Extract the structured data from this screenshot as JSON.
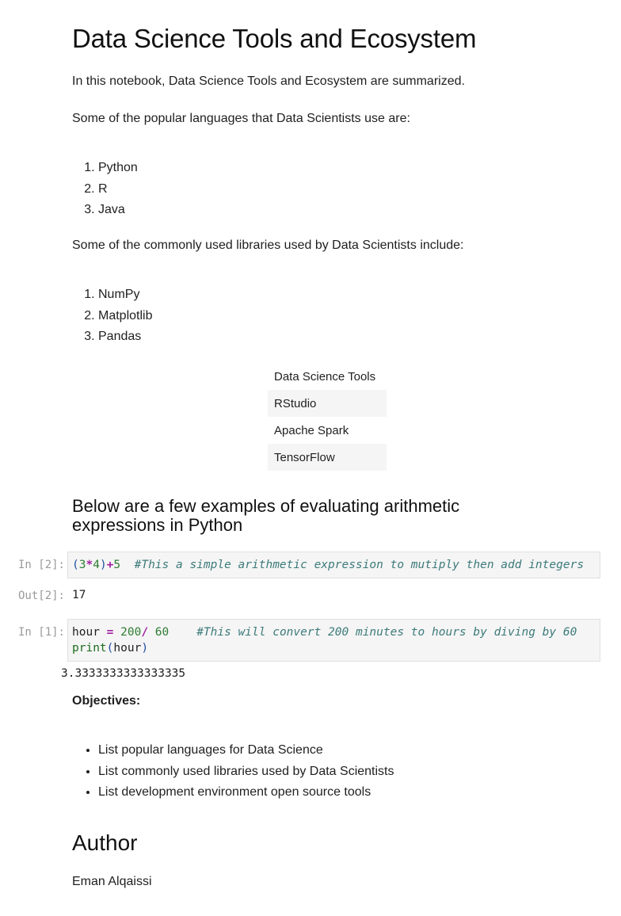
{
  "title": "Data Science Tools and Ecosystem",
  "intro": "In this notebook, Data Science Tools and Ecosystem are summarized.",
  "languages": {
    "heading": "Some of the popular languages that Data Scientists use are:",
    "items": [
      "Python",
      "R",
      "Java"
    ]
  },
  "libraries": {
    "heading": "Some of the commonly used libraries used by Data Scientists include:",
    "items": [
      "NumPy",
      "Matplotlib",
      "Pandas"
    ]
  },
  "tools_table": {
    "header": "Data Science Tools",
    "rows": [
      "RStudio",
      "Apache Spark",
      "TensorFlow"
    ]
  },
  "arith_heading": "Below are a few examples of evaluating arithmetic expressions in Python",
  "cells": [
    {
      "prompt": "In [2]:",
      "out_prompt": "Out[2]:",
      "code": {
        "p1": "(",
        "n1": "3",
        "op1": "*",
        "n2": "4",
        "p2": ")",
        "op2": "+",
        "n3": "5",
        "comment": "#This a simple arithmetic expression to mutiply then add integers"
      },
      "output": "17"
    },
    {
      "prompt": "In [1]:",
      "code": {
        "var": "hour ",
        "eq": "=",
        "n1": "200",
        "div": "/",
        "n2": "60",
        "comment": "#This will convert 200 minutes to hours by diving by 60",
        "fn": "print",
        "lp": "(",
        "arg": "hour",
        "rp": ")"
      },
      "output": "3.3333333333333335"
    }
  ],
  "objectives": {
    "heading": "Objectives:",
    "items": [
      "List popular languages for Data Science",
      "List commonly used libraries used by Data Scientists",
      "List development environment open source tools"
    ]
  },
  "author": {
    "heading": "Author",
    "name": "Eman Alqaissi"
  }
}
